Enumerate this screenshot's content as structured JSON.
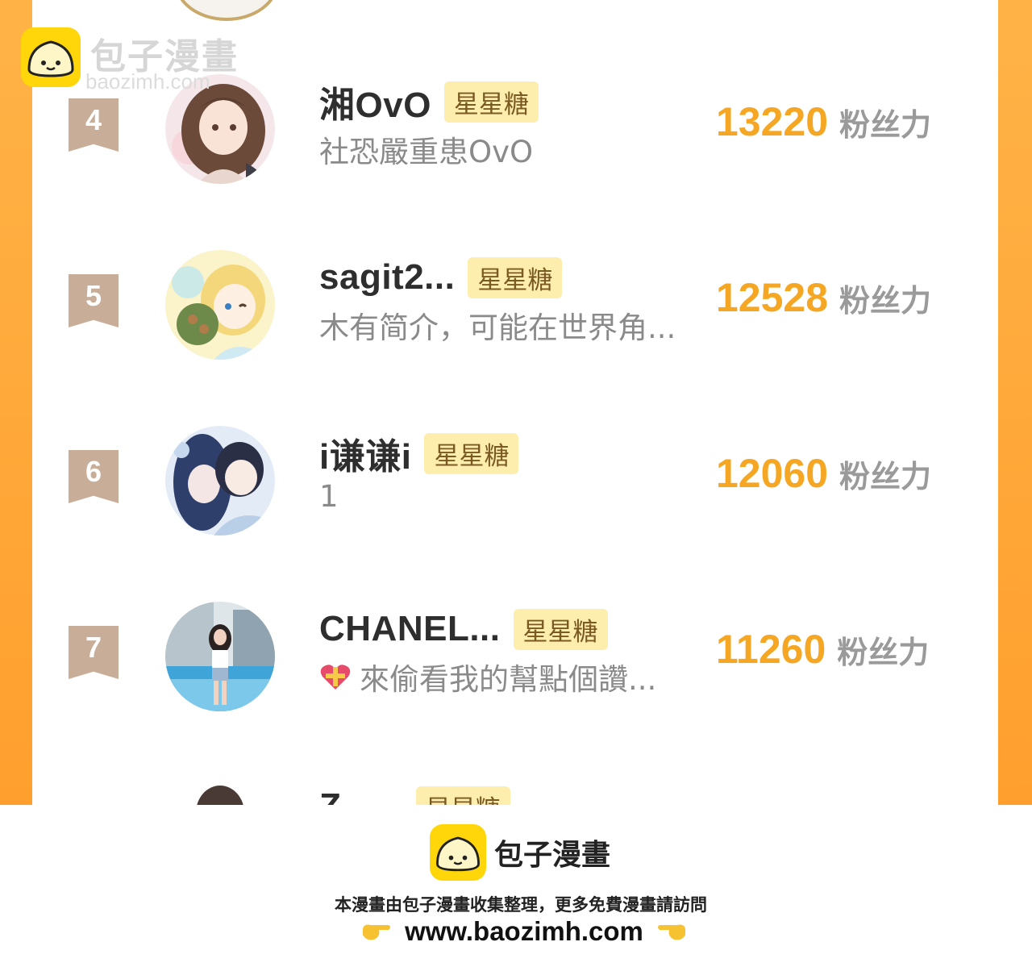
{
  "fan_unit": "粉丝力",
  "tag_label": "星星糖",
  "rows": [
    {
      "rank": "4",
      "name": "湘OvO",
      "bio": "社恐嚴重患OvO",
      "score": "13220"
    },
    {
      "rank": "5",
      "name": "sagit2...",
      "bio": "木有简介，可能在世界角...",
      "score": "12528"
    },
    {
      "rank": "6",
      "name": "i谦谦i",
      "bio": "1",
      "score": "12060"
    },
    {
      "rank": "7",
      "name": "CHANEL...",
      "bio": "來偷看我的幫點個讚...",
      "score": "11260"
    }
  ],
  "partial_row": {
    "name": "Z......",
    "tag": "星星糖"
  },
  "watermark": {
    "title": "包子漫畫",
    "url": "baozimh.com"
  },
  "footer": {
    "brand": "包子漫畫",
    "note": "本漫畫由包子漫畫收集整理，更多免費漫畫請訪問",
    "url": "www.baozimh.com"
  },
  "colors": {
    "frame": "#ffa53a",
    "score": "#f5a623",
    "tag_bg": "#fdeeae",
    "rank_badge": "#c8ad99",
    "logo": "#ffd60a"
  }
}
